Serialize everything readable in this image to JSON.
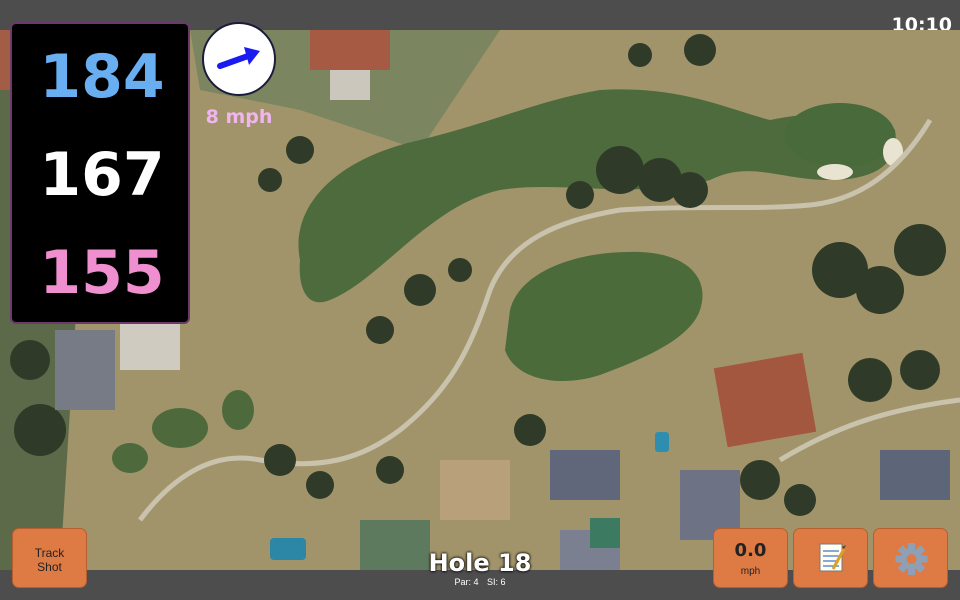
{
  "status_bar": {
    "time": "10:10"
  },
  "yardages": {
    "back": "184",
    "middle": "167",
    "front": "155"
  },
  "wind": {
    "speed": "8 mph",
    "icon": "wind-direction-arrow-icon"
  },
  "hole": {
    "title": "Hole 18",
    "par": "Par: 4",
    "stroke_index": "SI: 6"
  },
  "buttons": {
    "track_shot_line1": "Track",
    "track_shot_line2": "Shot",
    "speed_value": "0.0",
    "speed_unit": "mph",
    "notes_icon": "notepad-icon",
    "settings_icon": "gear-icon"
  },
  "colors": {
    "back_yardage": "#69aef0",
    "middle_yardage": "#ffffff",
    "front_yardage": "#ef8fcf",
    "button_orange": "#de7b44",
    "wind_text": "#f0b4ef"
  }
}
